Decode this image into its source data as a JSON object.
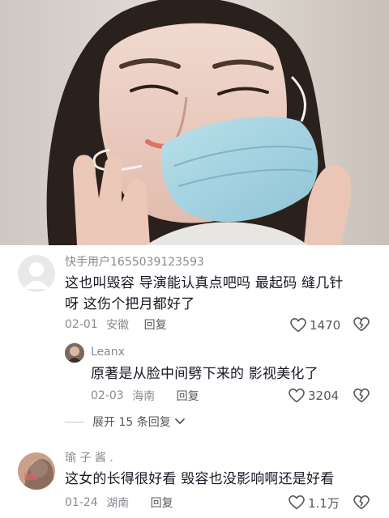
{
  "video": {
    "icon": "video-still-woman-wearing-mask"
  },
  "comments": [
    {
      "username": "快手用户1655039123593",
      "text_line1": "这也叫毁容 导演能认真点吧吗 最起码 缝几针",
      "text_line2": "呀 这伤个把月都好了",
      "date": "02-01",
      "location": "安徽",
      "reply_label": "回复",
      "likes": "1470",
      "avatar_icon": "default-user-avatar",
      "replies": [
        {
          "username": "Leanx",
          "text": "原著是从脸中间劈下来的 影视美化了",
          "date": "02-03",
          "location": "海南",
          "reply_label": "回复",
          "likes": "3204",
          "avatar_icon": "user-photo-avatar"
        }
      ],
      "expand_label": "展开 15 条回复"
    },
    {
      "username": "瑜 子 酱 .",
      "text": "这女的长得很好看 毁容也没影响啊还是好看",
      "date": "01-24",
      "location": "湖南",
      "reply_label": "回复",
      "likes": "1.1万",
      "avatar_icon": "user-photo-avatar"
    }
  ],
  "icons": {
    "like": "heart-outline-icon",
    "dislike": "broken-heart-icon",
    "expand": "chevron-down-icon"
  },
  "colors": {
    "text_primary": "#161823",
    "text_secondary": "#8a8b91",
    "mask": "#9fcfe0"
  }
}
